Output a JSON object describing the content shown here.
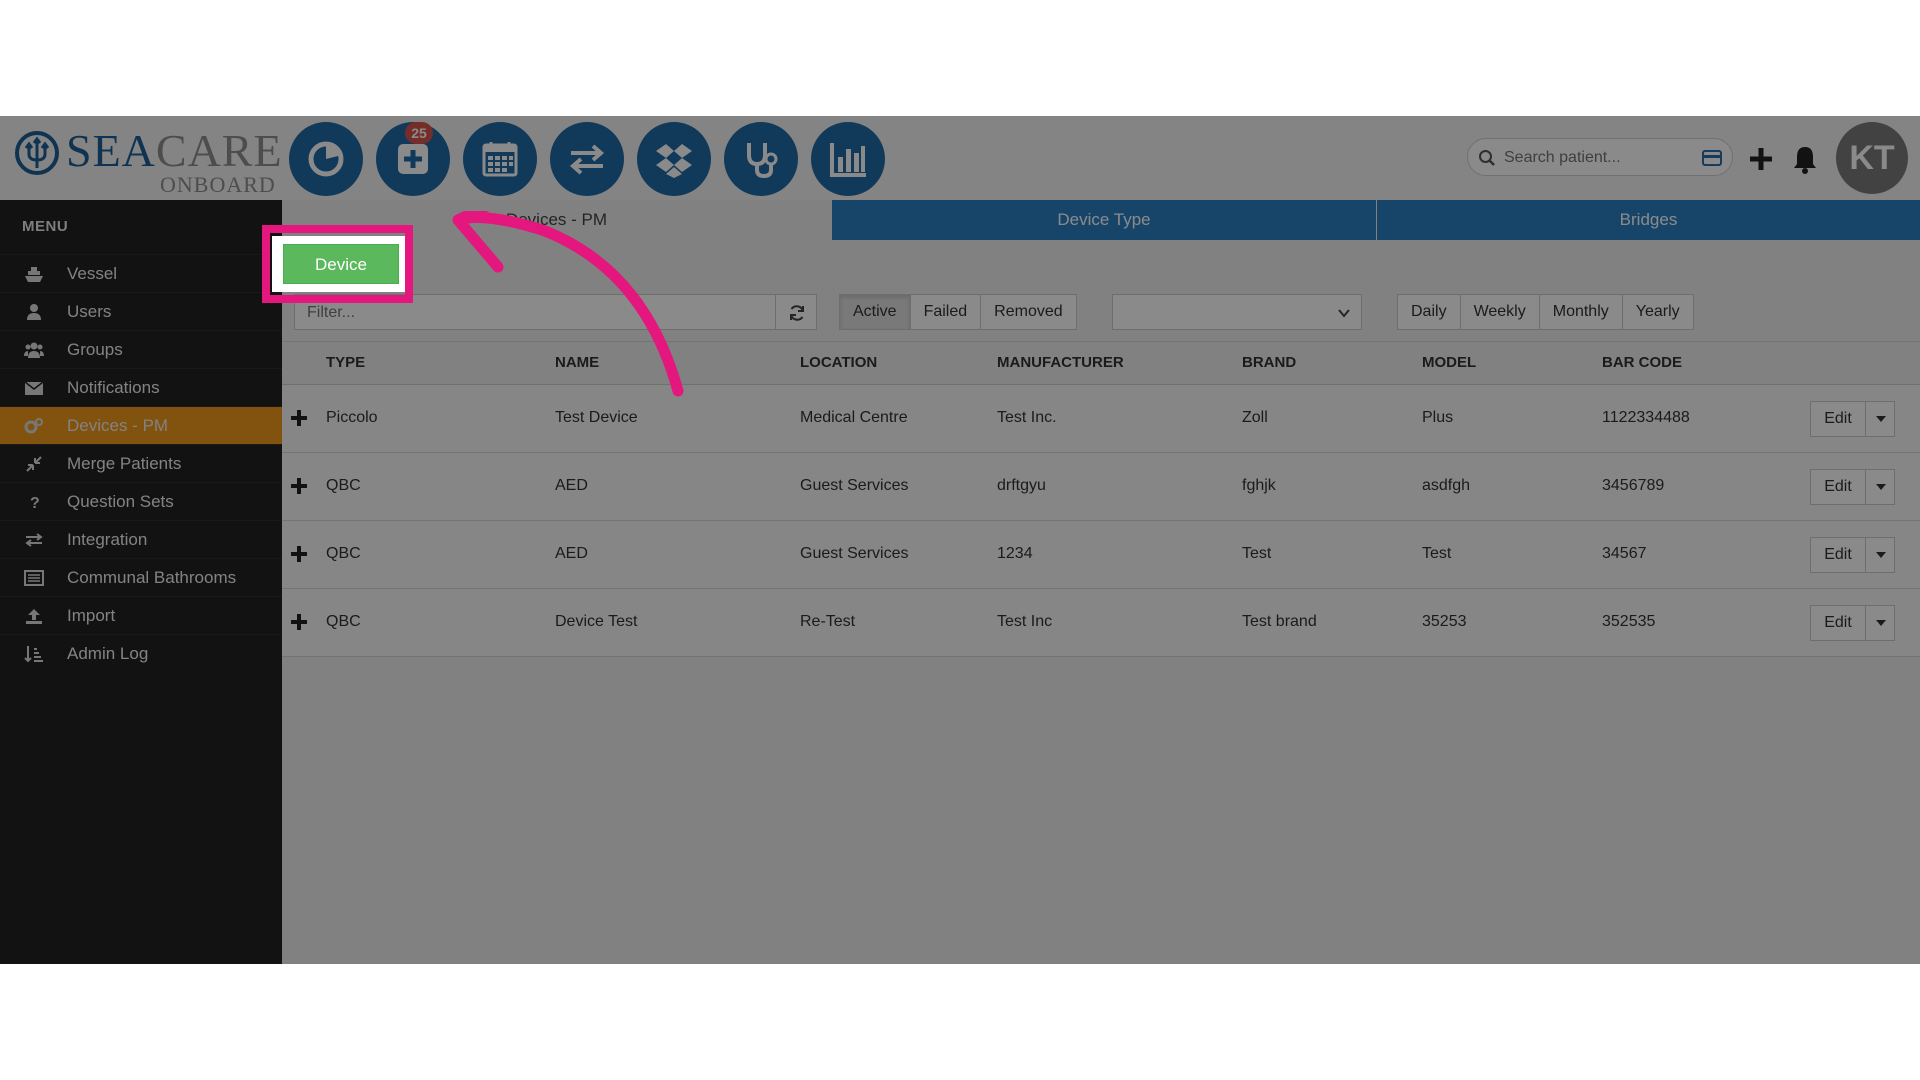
{
  "brand": {
    "word_sea": "SEA",
    "word_care": "CARE",
    "sub": "ONBOARD"
  },
  "header": {
    "nav_icons": [
      "dashboard-pie-icon",
      "medical-plus-icon",
      "calendar-icon",
      "transfer-arrows-icon",
      "dropbox-icon",
      "stethoscope-icon",
      "bar-chart-icon"
    ],
    "badge_count": "25",
    "search_placeholder": "Search patient...",
    "avatar_initials": "KT"
  },
  "sidebar": {
    "title": "MENU",
    "items": [
      {
        "label": "Vessel",
        "icon": "vessel-icon"
      },
      {
        "label": "Users",
        "icon": "user-icon"
      },
      {
        "label": "Groups",
        "icon": "groups-icon"
      },
      {
        "label": "Notifications",
        "icon": "envelope-icon"
      },
      {
        "label": "Devices - PM",
        "icon": "cogs-icon",
        "active": true
      },
      {
        "label": "Merge Patients",
        "icon": "compress-icon"
      },
      {
        "label": "Question Sets",
        "icon": "question-icon"
      },
      {
        "label": "Integration",
        "icon": "exchange-icon"
      },
      {
        "label": "Communal Bathrooms",
        "icon": "list-alt-icon"
      },
      {
        "label": "Import",
        "icon": "upload-icon"
      },
      {
        "label": "Admin Log",
        "icon": "sort-list-icon"
      }
    ]
  },
  "tabs": [
    "Devices - PM",
    "Device Type",
    "Bridges"
  ],
  "device_button": "Device",
  "filter": {
    "placeholder": "Filter...",
    "status_buttons": [
      "Active",
      "Failed",
      "Removed"
    ],
    "status_selected": "Active",
    "select_value": "",
    "period_buttons": [
      "Daily",
      "Weekly",
      "Monthly",
      "Yearly"
    ]
  },
  "table": {
    "columns": [
      "TYPE",
      "NAME",
      "LOCATION",
      "MANUFACTURER",
      "BRAND",
      "MODEL",
      "BAR CODE"
    ],
    "rows": [
      [
        "Piccolo",
        "Test Device",
        "Medical Centre",
        "Test Inc.",
        "Zoll",
        "Plus",
        "1122334488"
      ],
      [
        "QBC",
        "AED",
        "Guest Services",
        "drftgyu",
        "fghjk",
        "asdfgh",
        "3456789"
      ],
      [
        "QBC",
        "AED",
        "Guest Services",
        "1234",
        "Test",
        "Test",
        "34567"
      ],
      [
        "QBC",
        "Device Test",
        "Re-Test",
        "Test Inc",
        "Test brand",
        "35253",
        "352535"
      ]
    ],
    "edit_label": "Edit"
  },
  "colors": {
    "brand_blue": "#1e6aa6",
    "tab_blue": "#2b80c5",
    "active_orange": "#ef9a1a",
    "green": "#5cb85c",
    "highlight_pink": "#e3177e"
  }
}
